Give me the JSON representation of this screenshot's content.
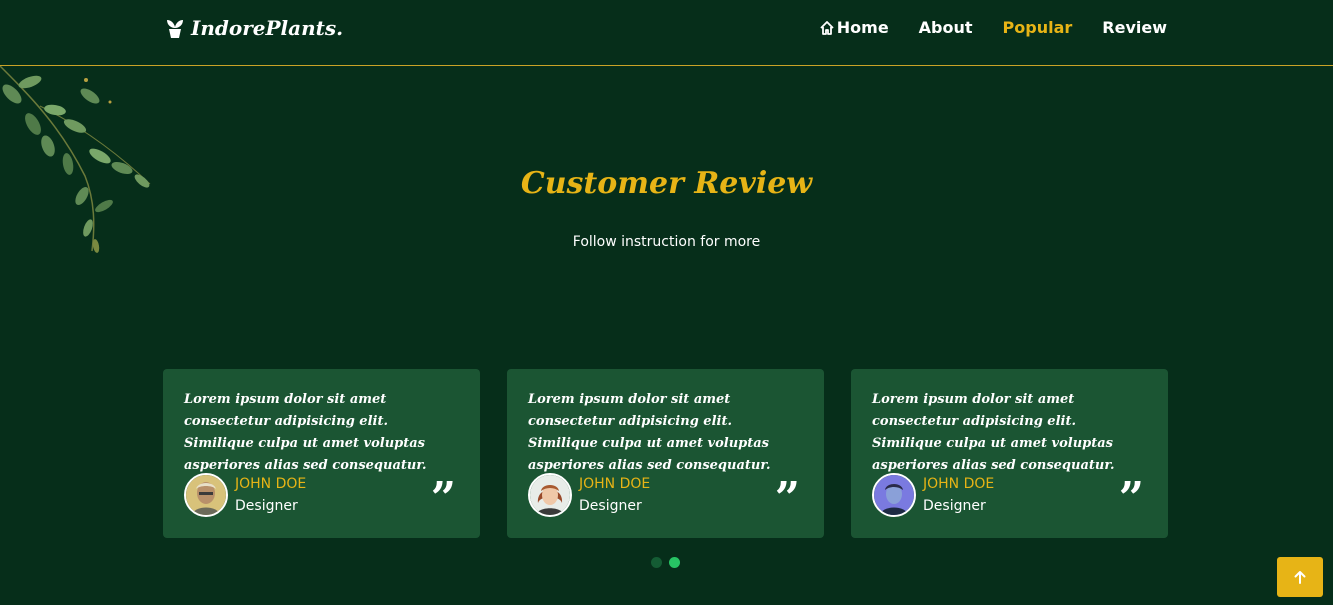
{
  "header": {
    "logo_text": "IndorePlants.",
    "nav": [
      {
        "label": "Home",
        "icon": "home-icon",
        "active": false
      },
      {
        "label": "About",
        "active": false
      },
      {
        "label": "Popular",
        "active": true
      },
      {
        "label": "Review",
        "active": false
      }
    ]
  },
  "section": {
    "title": "Customer Review",
    "subtitle": "Follow instruction for more"
  },
  "reviews": [
    {
      "text": "Lorem ipsum dolor sit amet consectetur adipisicing elit. Similique culpa ut amet voluptas asperiores alias sed consequatur.",
      "name": "JOHN DOE",
      "role": "Designer",
      "quote": "”"
    },
    {
      "text": "Lorem ipsum dolor sit amet consectetur adipisicing elit. Similique culpa ut amet voluptas asperiores alias sed consequatur.",
      "name": "JOHN DOE",
      "role": "Designer",
      "quote": "”"
    },
    {
      "text": "Lorem ipsum dolor sit amet consectetur adipisicing elit. Similique culpa ut amet voluptas asperiores alias sed consequatur.",
      "name": "JOHN DOE",
      "role": "Designer",
      "quote": "”"
    }
  ],
  "pagination": {
    "pages": 2,
    "active": 2
  },
  "colors": {
    "background": "#062e1a",
    "card": "#1b5533",
    "accent": "#e7b416",
    "dot_active": "#27c464"
  },
  "scroll_top_icon": "arrow-up-icon"
}
